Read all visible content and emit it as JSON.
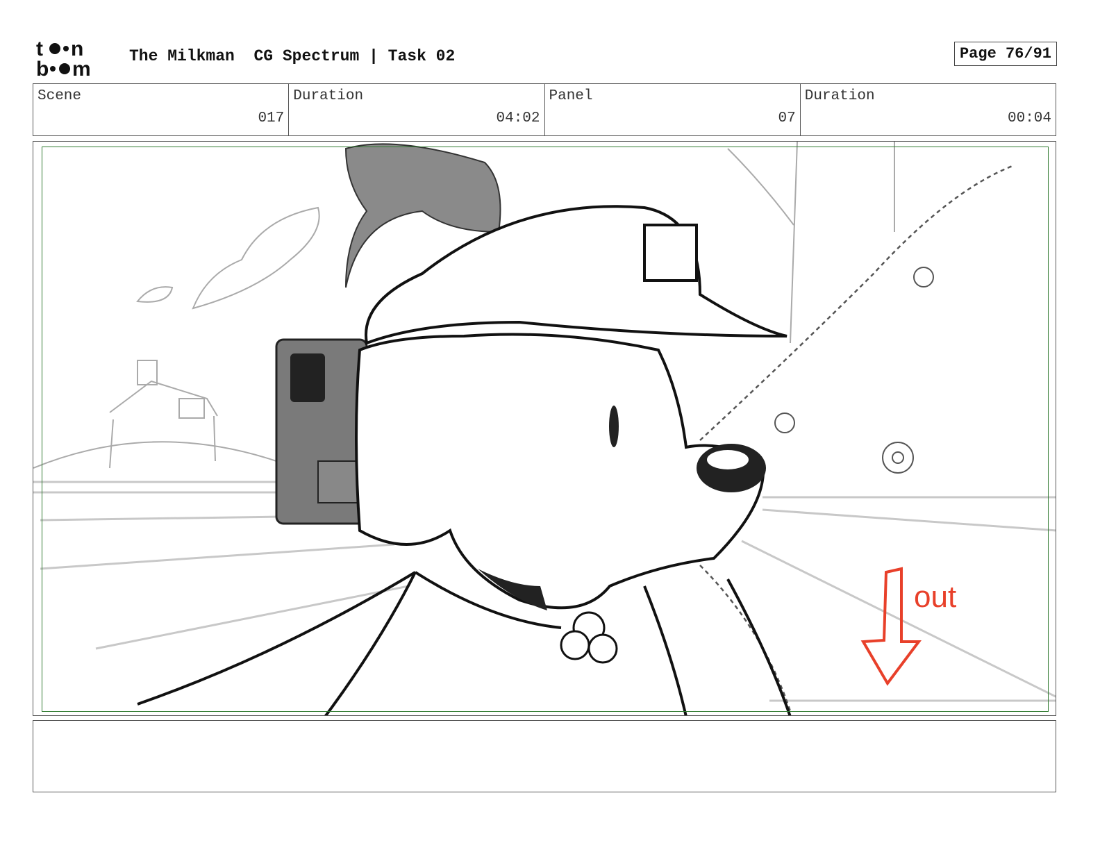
{
  "header": {
    "logo_text_top": "toon",
    "logo_text_bottom": "boom",
    "project_title": "The Milkman",
    "subtitle": "CG Spectrum | Task 02",
    "page_label": "Page 76/91"
  },
  "info": {
    "scene_label": "Scene",
    "scene_value": "017",
    "scene_duration_label": "Duration",
    "scene_duration_value": "04:02",
    "panel_label": "Panel",
    "panel_value": "07",
    "panel_duration_label": "Duration",
    "panel_duration_value": "00:04"
  },
  "panel": {
    "annotation_text": "out",
    "annotation_color": "#e8402a",
    "safe_frame_color": "#2f7a2f",
    "icon": "arrow-down-icon"
  },
  "notes": {
    "text": ""
  }
}
